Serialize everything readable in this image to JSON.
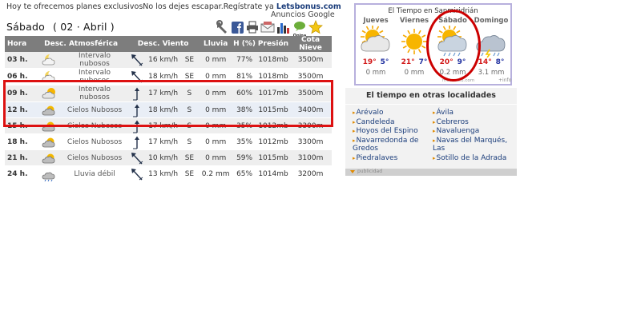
{
  "ad": {
    "text": "Hoy te ofrecemos planes exclusivosNo los dejes escapar.Regístrate ya ",
    "brand": "Letsbonus.com",
    "google": "Anuncios Google"
  },
  "day": {
    "name": "Sábado",
    "date": "( 02 · Abril )"
  },
  "toolbar": {
    "icons": [
      "wrench-icon",
      "facebook-icon",
      "print-icon",
      "email-icon",
      "chart-icon",
      "opina-icon",
      "star-icon"
    ],
    "opina_label": "Opina"
  },
  "table": {
    "headers": [
      "Hora",
      "Desc. Atmosférica",
      "Desc. Viento",
      "Lluvia",
      "H (%)",
      "Presión",
      "Cota Nieve"
    ],
    "rows": [
      {
        "hora": "03 h.",
        "desc": "Intervalo nubosos",
        "sky": "moon-cloud-icon",
        "wind_dir": "arrow-nw",
        "wind": "16 km/h",
        "dir": "SE",
        "lluvia": "0 mm",
        "h": "77%",
        "presion": "1018mb",
        "cota": "3500m"
      },
      {
        "hora": "06 h.",
        "desc": "Intervalo nubosos",
        "sky": "moon-cloud-icon",
        "wind_dir": "arrow-nw",
        "wind": "18 km/h",
        "dir": "SE",
        "lluvia": "0 mm",
        "h": "81%",
        "presion": "1018mb",
        "cota": "3500m"
      },
      {
        "hora": "09 h.",
        "desc": "Intervalo nubosos",
        "sky": "sun-cloud-icon",
        "wind_dir": "arrow-n",
        "wind": "17 km/h",
        "dir": "S",
        "lluvia": "0 mm",
        "h": "60%",
        "presion": "1017mb",
        "cota": "3500m"
      },
      {
        "hora": "12 h.",
        "desc": "Cielos Nubosos",
        "sky": "cloud-sun-icon",
        "wind_dir": "arrow-n",
        "wind": "18 km/h",
        "dir": "S",
        "lluvia": "0 mm",
        "h": "38%",
        "presion": "1015mb",
        "cota": "3400m"
      },
      {
        "hora": "15 h.",
        "desc": "Cielos Nubosos",
        "sky": "cloud-sun-icon",
        "wind_dir": "arrow-n",
        "wind": "17 km/h",
        "dir": "S",
        "lluvia": "0 mm",
        "h": "35%",
        "presion": "1012mb",
        "cota": "3300m"
      },
      {
        "hora": "18 h.",
        "desc": "Cielos Nubosos",
        "sky": "cloud-sun-icon",
        "wind_dir": "arrow-n",
        "wind": "17 km/h",
        "dir": "S",
        "lluvia": "0 mm",
        "h": "35%",
        "presion": "1012mb",
        "cota": "3300m"
      },
      {
        "hora": "21 h.",
        "desc": "Cielos Nubosos",
        "sky": "cloud-sun-icon",
        "wind_dir": "arrow-nw",
        "wind": "10 km/h",
        "dir": "SE",
        "lluvia": "0 mm",
        "h": "59%",
        "presion": "1015mb",
        "cota": "3100m"
      },
      {
        "hora": "24 h.",
        "desc": "Lluvia débil",
        "sky": "rain-cloud-icon",
        "wind_dir": "arrow-nw",
        "wind": "13 km/h",
        "dir": "SE",
        "lluvia": "0.2 mm",
        "h": "65%",
        "presion": "1014mb",
        "cota": "3200m"
      }
    ]
  },
  "widget": {
    "title": "El Tiempo en Sanmiridrián",
    "days": [
      {
        "name": "Jueves",
        "icon": "sun-cloud-icon",
        "max": "19°",
        "min": "5°",
        "rain": "0 mm"
      },
      {
        "name": "Viernes",
        "icon": "sun-icon",
        "max": "21°",
        "min": "7°",
        "rain": "0 mm"
      },
      {
        "name": "Sábado",
        "icon": "sun-cloud-rain-icon",
        "max": "20°",
        "min": "9°",
        "rain": "0.2 mm"
      },
      {
        "name": "Domingo",
        "icon": "storm-cloud-icon",
        "max": "14°",
        "min": "8°",
        "rain": "3.1 mm"
      }
    ],
    "credit": "meteored.com",
    "info": "+info"
  },
  "localities": {
    "title": "El tiempo en otras localidades",
    "left": [
      "Arévalo",
      "Candeleda",
      "Hoyos del Espino",
      "Navarredonda de Gredos",
      "Piedralaves"
    ],
    "right": [
      "Ávila",
      "Cebreros",
      "Navaluenga",
      "Navas del Marqués, Las",
      "Sotillo de la Adrada"
    ]
  },
  "publicidad": "publicidad",
  "colors": {
    "annotation_red": "#d11111",
    "header_gray": "#7d7d7d",
    "link_blue": "#1a3c7a",
    "max_red": "#d21a1a",
    "min_blue": "#2030a0"
  }
}
